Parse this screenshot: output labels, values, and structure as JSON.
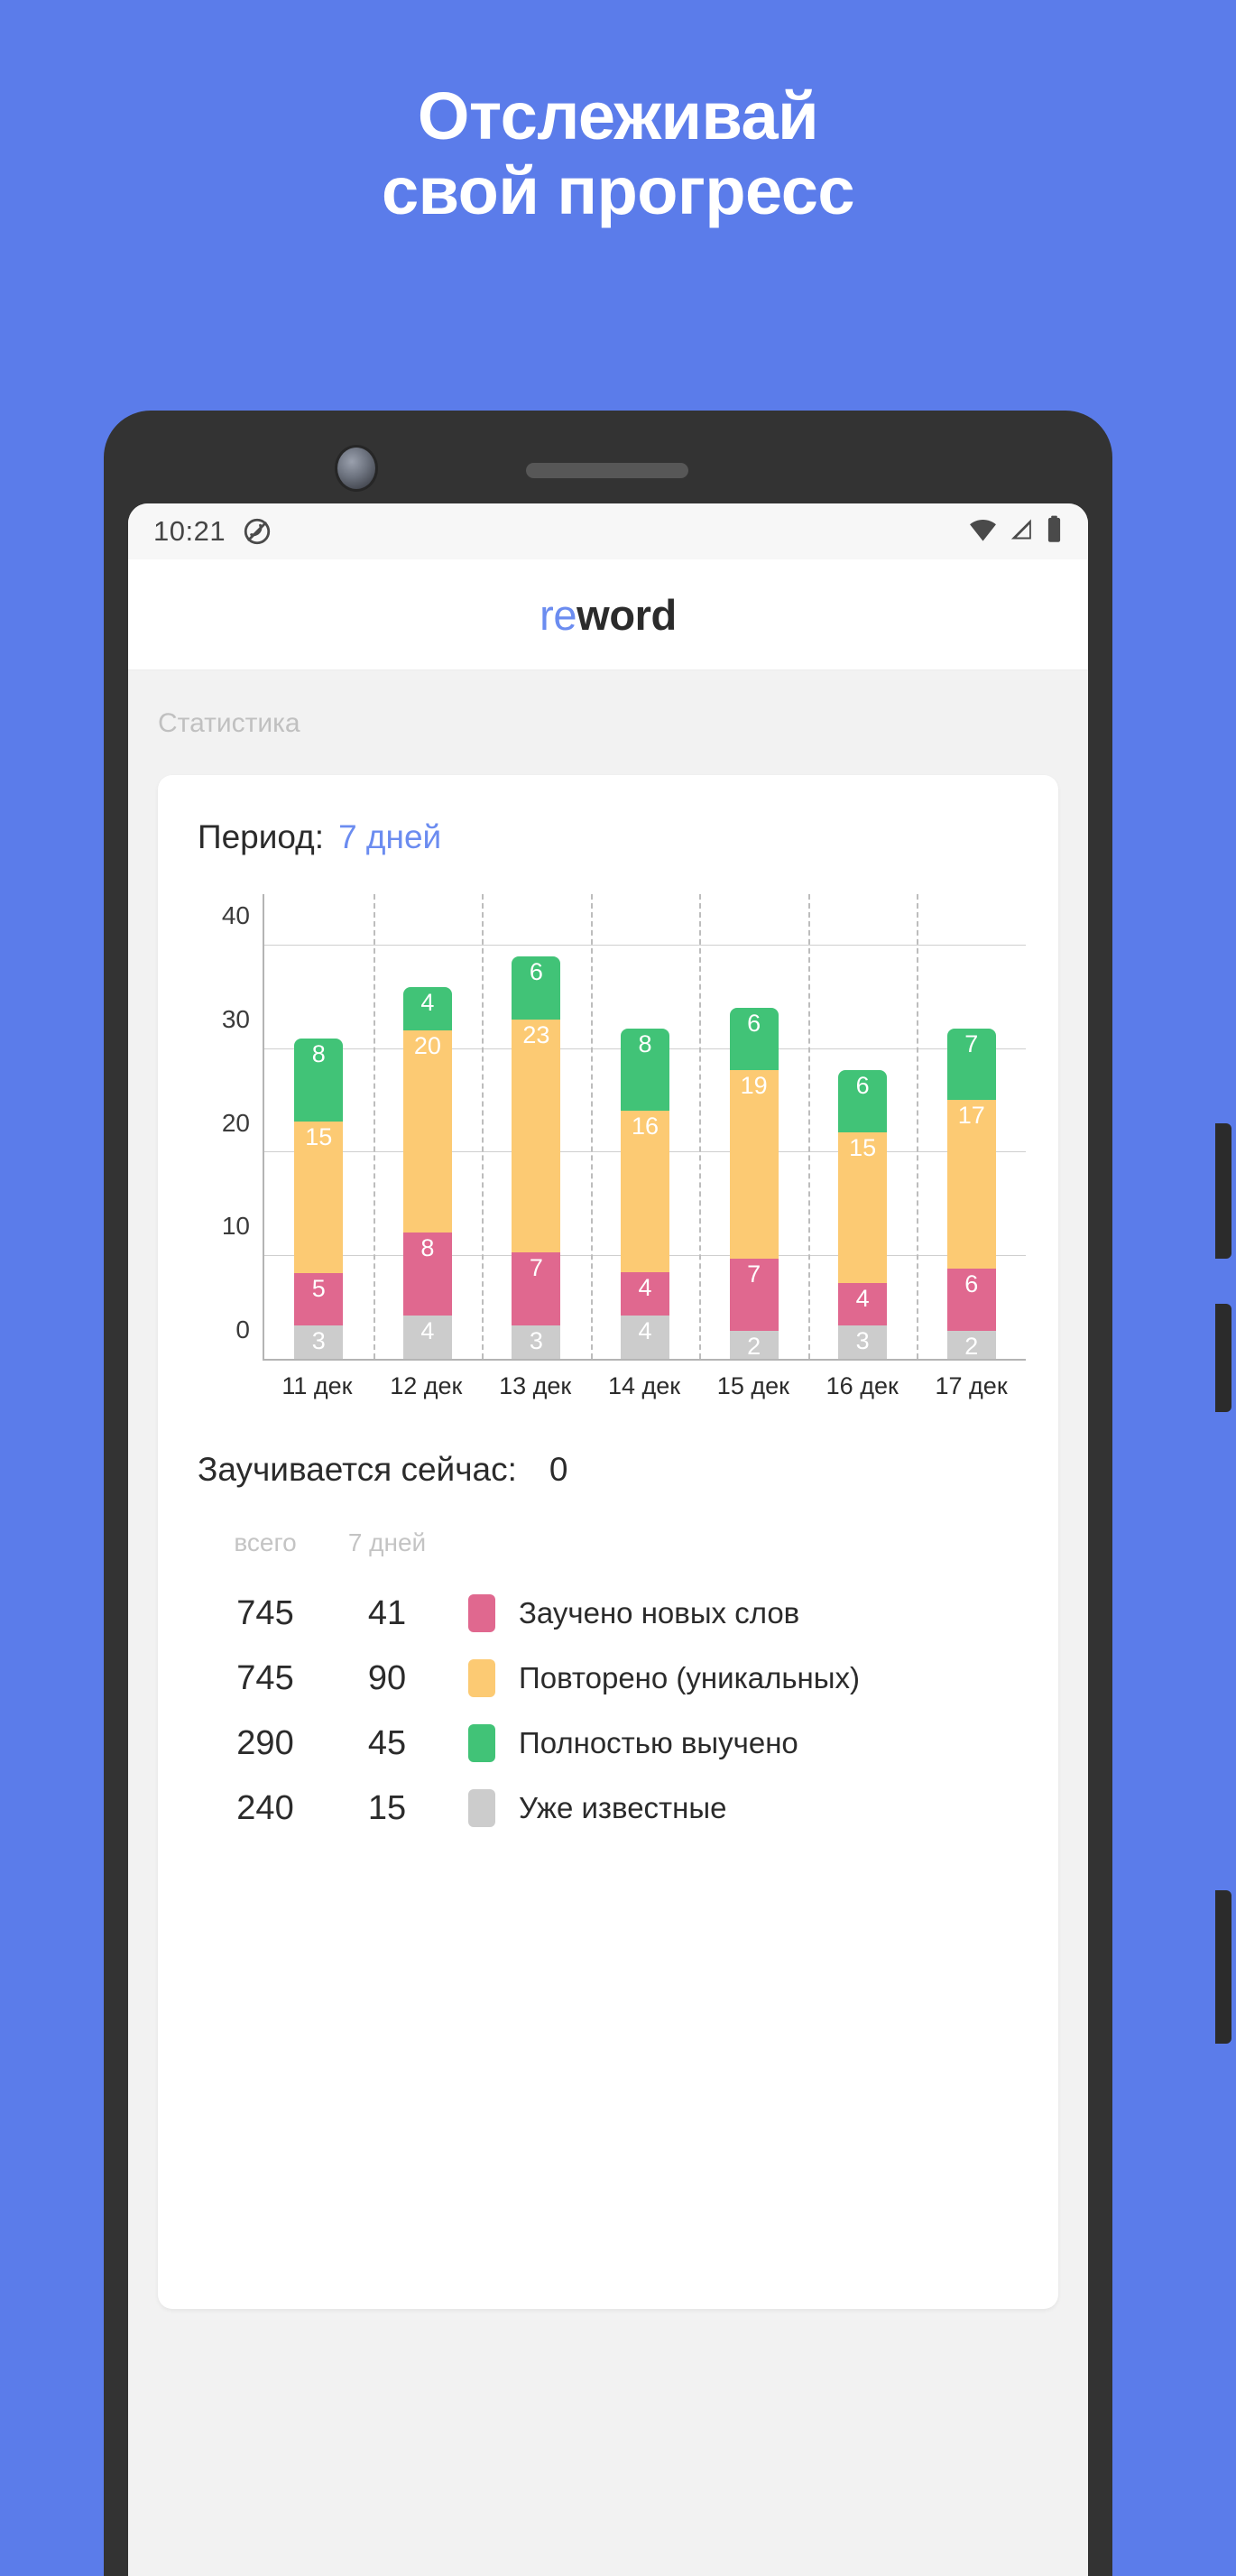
{
  "promo": {
    "line1": "Отслеживай",
    "line2": "свой прогресс",
    "bg_color": "#5b7cea",
    "text_color": "#ffffff"
  },
  "status_bar": {
    "time": "10:21",
    "dnd_icon": "do-not-disturb-icon",
    "wifi_icon": "wifi-icon",
    "signal_icon": "cell-signal-icon",
    "battery_icon": "battery-full-icon"
  },
  "app_header": {
    "logo_prefix": "re",
    "logo_suffix": "word",
    "logo_prefix_color": "#6b8cf0",
    "logo_suffix_color": "#2b2b2b"
  },
  "section": {
    "label": "Статистика"
  },
  "period": {
    "label": "Период:",
    "value": "7 дней",
    "value_color": "#6b8cf0"
  },
  "now_learning": {
    "label": "Заучивается сейчас:",
    "value": "0"
  },
  "table": {
    "headers": {
      "total": "всего",
      "week": "7 дней"
    },
    "rows": [
      {
        "total": "745",
        "week": "41",
        "color": "#e0688f",
        "label": "Заучено новых слов"
      },
      {
        "total": "745",
        "week": "90",
        "color": "#fcca73",
        "label": "Повторено (уникальных)"
      },
      {
        "total": "290",
        "week": "45",
        "color": "#41c377",
        "label": "Полностью выучено"
      },
      {
        "total": "240",
        "week": "15",
        "color": "#cccccc",
        "label": "Уже известные"
      }
    ]
  },
  "chart_data": {
    "type": "bar",
    "stacked": true,
    "title": "",
    "xlabel": "",
    "ylabel": "",
    "ylim": [
      0,
      45
    ],
    "yticks": [
      0,
      10,
      20,
      30,
      40
    ],
    "ytick_labels": [
      "0",
      "10",
      "20",
      "30",
      "40"
    ],
    "grid": true,
    "categories": [
      "11 дек",
      "12 дек",
      "13 дек",
      "14 дек",
      "15 дек",
      "16 дек",
      "17 дек"
    ],
    "series": [
      {
        "name": "Уже известные",
        "color": "#cccccc",
        "values": [
          3,
          4,
          3,
          4,
          2,
          3,
          2
        ]
      },
      {
        "name": "Заучено новых слов",
        "color": "#e0688f",
        "values": [
          5,
          8,
          7,
          4,
          7,
          4,
          6
        ]
      },
      {
        "name": "Повторено (уникальных)",
        "color": "#fcca73",
        "values": [
          15,
          20,
          23,
          16,
          19,
          15,
          17
        ]
      },
      {
        "name": "Полностью выучено",
        "color": "#41c377",
        "values": [
          8,
          4,
          6,
          8,
          6,
          6,
          7
        ]
      }
    ],
    "totals": [
      31,
      36,
      39,
      32,
      34,
      28,
      32
    ]
  }
}
